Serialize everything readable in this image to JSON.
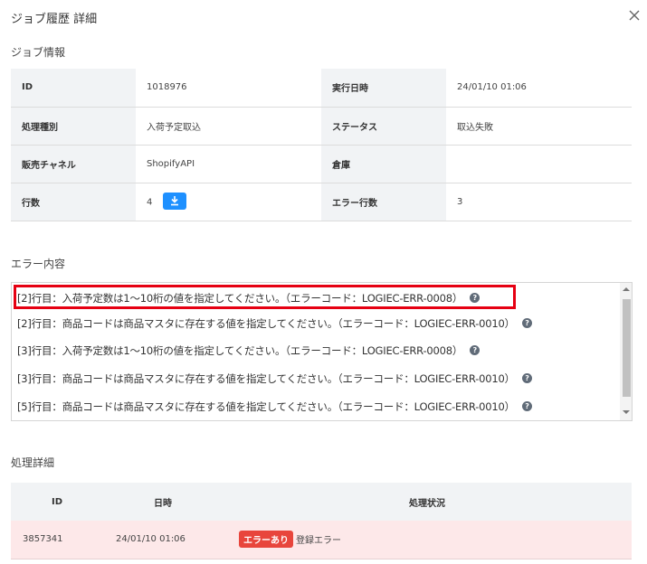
{
  "modal": {
    "title": "ジョブ履歴 詳細"
  },
  "job_info": {
    "section_title": "ジョブ情報",
    "rows": [
      {
        "label1": "ID",
        "value1": "1018976",
        "label2": "実行日時",
        "value2": "24/01/10 01:06"
      },
      {
        "label1": "処理種別",
        "value1": "入荷予定取込",
        "label2": "ステータス",
        "value2": "取込失敗"
      },
      {
        "label1": "販売チャネル",
        "value1": "ShopifyAPI",
        "label2": "倉庫",
        "value2": ""
      },
      {
        "label1": "行数",
        "value1": "4",
        "label2": "エラー行数",
        "value2": "3"
      }
    ]
  },
  "errors": {
    "section_title": "エラー内容",
    "lines": [
      "[2]行目：入荷予定数は1～10桁の値を指定してください。（エラーコード：LOGIEC-ERR-0008）",
      "[2]行目：商品コードは商品マスタに存在する値を指定してください。（エラーコード：LOGIEC-ERR-0010）",
      "[3]行目：入荷予定数は1～10桁の値を指定してください。（エラーコード：LOGIEC-ERR-0008）",
      "[3]行目：商品コードは商品マスタに存在する値を指定してください。（エラーコード：LOGIEC-ERR-0010）",
      "[5]行目：商品コードは商品マスタに存在する値を指定してください。（エラーコード：LOGIEC-ERR-0010）"
    ]
  },
  "process": {
    "section_title": "処理詳細",
    "headers": {
      "id": "ID",
      "date": "日時",
      "status": "処理状況"
    },
    "rows": [
      {
        "id": "3857341",
        "date": "24/01/10 01:06",
        "badge": "エラーあり",
        "status": "登録エラー"
      }
    ]
  },
  "colors": {
    "accent": "#1e90ff",
    "error": "#e8453c",
    "highlight": "#e60012",
    "error_row_bg": "#fde8e9"
  }
}
